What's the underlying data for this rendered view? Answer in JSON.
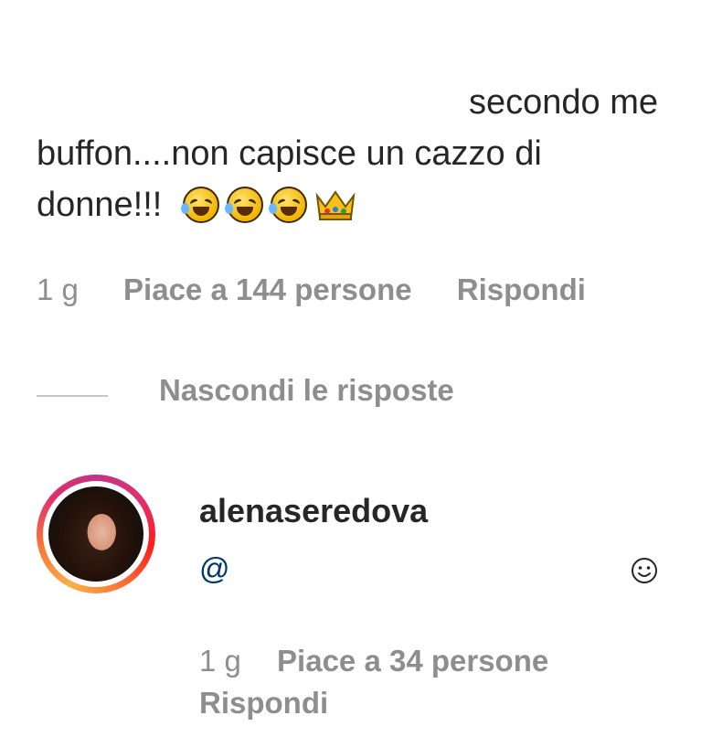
{
  "comment": {
    "line1": "secondo me",
    "line2": "buffon....non capisce un cazzo di",
    "line3": "donne!!!",
    "emojis": [
      "rolling-on-floor-laughing-icon",
      "rolling-on-floor-laughing-icon",
      "rolling-on-floor-laughing-icon",
      "crown-icon"
    ],
    "time": "1 g",
    "likes": "Piace a 144 persone",
    "reply": "Rispondi"
  },
  "replies_toggle": "Nascondi le risposte",
  "reply_comment": {
    "username": "alenaseredova",
    "mention": "@",
    "time": "1 g",
    "likes": "Piace a 34 persone",
    "reply": "Rispondi"
  },
  "colors": {
    "text": "#262626",
    "muted": "#8e8e8e",
    "mention": "#00376b",
    "ring_start": "#c13584",
    "ring_end": "#fcaf45"
  }
}
